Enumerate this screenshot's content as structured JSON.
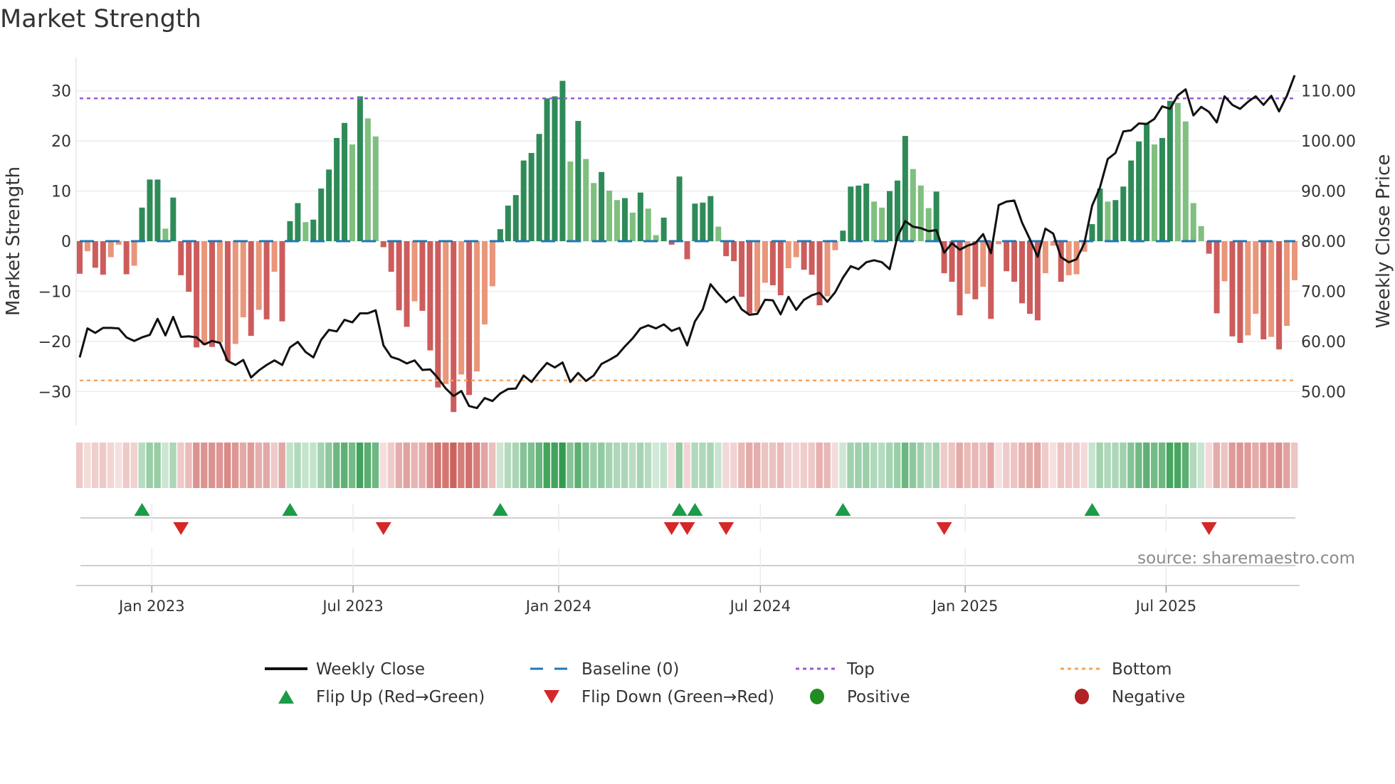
{
  "title": "Market Strength",
  "source": "source: sharemaestro.com",
  "chart_data": {
    "type": "bar",
    "title": "Market Strength",
    "ylabel": "Market Strength",
    "y2label": "Weekly Close Price",
    "ylim": [
      -36.7,
      36.7
    ],
    "y2lim": [
      43.3,
      116.7
    ],
    "yticks": [
      {
        "v": 30,
        "label": "30"
      },
      {
        "v": 20,
        "label": "20"
      },
      {
        "v": 10,
        "label": "10"
      },
      {
        "v": 0,
        "label": "0"
      },
      {
        "v": -10,
        "label": "−10"
      },
      {
        "v": -20,
        "label": "−20"
      },
      {
        "v": -30,
        "label": "−30"
      }
    ],
    "y2ticks": [
      {
        "v": 110,
        "label": "110.00"
      },
      {
        "v": 100,
        "label": "100.00"
      },
      {
        "v": 90,
        "label": "90.00"
      },
      {
        "v": 80,
        "label": "80.00"
      },
      {
        "v": 70,
        "label": "70.00"
      },
      {
        "v": 60,
        "label": "60.00"
      },
      {
        "v": 50,
        "label": "50.00"
      }
    ],
    "xticks": [
      {
        "week": 9.26,
        "label": "Jan 2023"
      },
      {
        "week": 35.1,
        "label": "Jul 2023"
      },
      {
        "week": 61.5,
        "label": "Jan 2024"
      },
      {
        "week": 87.4,
        "label": "Jul 2024"
      },
      {
        "week": 113.7,
        "label": "Jan 2025"
      },
      {
        "week": 139.5,
        "label": "Jul 2025"
      }
    ],
    "top_level": 28.5,
    "bottom_level": -27.8,
    "baseline": 0,
    "strength": [
      -6.5,
      -2,
      -5.3,
      -6.7,
      -3.2,
      -0.7,
      -6.6,
      -4.9,
      6.7,
      12.3,
      12.3,
      2.5,
      8.7,
      -6.8,
      -10.1,
      -21.2,
      -20.7,
      -21.1,
      -20.2,
      -23.9,
      -20.5,
      -15.2,
      -18.9,
      -13.7,
      -15.6,
      -6.1,
      -16.0,
      4.0,
      7.6,
      3.8,
      4.3,
      10.5,
      14.3,
      20.6,
      23.6,
      19.3,
      28.9,
      24.5,
      20.9,
      -1.2,
      -6.1,
      -13.8,
      -17.1,
      -12,
      -13.9,
      -21.8,
      -29.2,
      -28.5,
      -34.1,
      -26.6,
      -30.7,
      -26,
      -16.6,
      -9,
      2.4,
      7.1,
      9.2,
      16.1,
      17.6,
      21.4,
      28.5,
      28.9,
      32,
      15.9,
      24,
      16.4,
      11.6,
      13.8,
      10.1,
      8.2,
      8.6,
      5.7,
      9.7,
      6.5,
      1.2,
      4.7,
      -0.7,
      12.9,
      -3.6,
      7.5,
      7.7,
      9.0,
      2.9,
      -3,
      -4,
      -11.1,
      -14.4,
      -14.1,
      -8.3,
      -8.8,
      -10.8,
      -5.4,
      -3.2,
      -5.7,
      -6.7,
      -12.8,
      -11,
      -1.8,
      2.1,
      10.9,
      11.1,
      11.5,
      7.9,
      6.7,
      10,
      12.1,
      21,
      14.4,
      11.1,
      6.6,
      9.9,
      -6.4,
      -8.1,
      -14.8,
      -10.5,
      -11.6,
      -9.1,
      -15.5,
      -0.6,
      -6,
      -8.1,
      -12.4,
      -14.5,
      -15.8,
      -6.4,
      -0.9,
      -8.1,
      -6.8,
      -6.6,
      -2.1,
      3.4,
      10.5,
      7.9,
      8.2,
      10.9,
      16.1,
      19.9,
      23.5,
      19.3,
      20.6,
      28,
      27.6,
      23.9,
      7.6,
      3,
      -2.5,
      -14.4,
      -8,
      -19,
      -20.3,
      -18.8,
      -14.5,
      -19.6,
      -19.1,
      -21.6,
      -16.9,
      -7.8
    ],
    "weekly_close": [
      56.8,
      62.6,
      61.7,
      62.7,
      62.7,
      62.6,
      60.8,
      60.1,
      60.8,
      61.3,
      64.5,
      61.2,
      64.9,
      60.9,
      61.0,
      60.8,
      59.4,
      60.1,
      59.7,
      56.1,
      55.3,
      56.3,
      52.8,
      54.2,
      55.3,
      56.2,
      55.3,
      58.8,
      59.9,
      57.9,
      56.8,
      60.3,
      62.3,
      62.0,
      64.3,
      63.8,
      65.6,
      65.6,
      66.2,
      59.2,
      56.9,
      56.4,
      55.6,
      56.2,
      54.3,
      54.4,
      52.7,
      50.6,
      49.1,
      50.1,
      47.1,
      46.7,
      48.7,
      48.1,
      49.6,
      50.5,
      50.6,
      53.2,
      51.9,
      53.9,
      55.7,
      54.8,
      55.8,
      51.9,
      53.7,
      52.1,
      53.2,
      55.5,
      56.3,
      57.2,
      59.0,
      60.6,
      62.6,
      63.2,
      62.6,
      63.4,
      62.1,
      62.7,
      59.2,
      64.0,
      66.4,
      71.4,
      69.5,
      67.8,
      68.9,
      66.4,
      65.3,
      65.5,
      68.3,
      68.2,
      65.4,
      68.9,
      66.3,
      68.3,
      69.2,
      69.7,
      67.9,
      69.8,
      72.7,
      75.0,
      74.4,
      75.8,
      76.2,
      75.8,
      74.4,
      80.9,
      84.0,
      82.9,
      82.6,
      82.0,
      82.2,
      77.7,
      79.6,
      78.3,
      79.1,
      79.6,
      81.4,
      77.6,
      87.2,
      87.9,
      88.1,
      83.7,
      80.4,
      76.9,
      82.5,
      81.5,
      76.8,
      75.8,
      76.4,
      79.6,
      87.1,
      90.7,
      96.4,
      97.6,
      101.9,
      102.1,
      103.5,
      103.4,
      104.4,
      106.9,
      106.4,
      109.1,
      110.3,
      105.1,
      106.8,
      105.8,
      103.7,
      108.9,
      107.2,
      106.4,
      107.8,
      108.9,
      107.2,
      109.0,
      105.9,
      109.0,
      113.1
    ],
    "legend": {
      "position": "bottom",
      "items": [
        {
          "label": "Weekly Close",
          "kind": "line",
          "color": "#111111"
        },
        {
          "label": "Baseline (0)",
          "kind": "dash",
          "color": "#1f77b4"
        },
        {
          "label": "Top",
          "kind": "dot",
          "color": "#9b59d6"
        },
        {
          "label": "Bottom",
          "kind": "dot",
          "color": "#f4a460"
        },
        {
          "label": "Flip Up (Red→Green)",
          "kind": "up",
          "color": "#1a9c48"
        },
        {
          "label": "Flip Down (Green→Red)",
          "kind": "down",
          "color": "#d62728"
        },
        {
          "label": "Positive",
          "kind": "dot-marker",
          "color": "#228b22"
        },
        {
          "label": "Negative",
          "kind": "dot-marker",
          "color": "#b22222"
        }
      ]
    }
  },
  "colors": {
    "pos_strong": "#2e8b57",
    "pos_weak": "#7fbf7f",
    "neg_strong": "#cd5c5c",
    "neg_weak": "#e9967a",
    "flip_up": "#1a9c48",
    "flip_down": "#d62728",
    "baseline": "#1f77b4",
    "top": "#9b59d6",
    "bottom": "#f4a460"
  }
}
